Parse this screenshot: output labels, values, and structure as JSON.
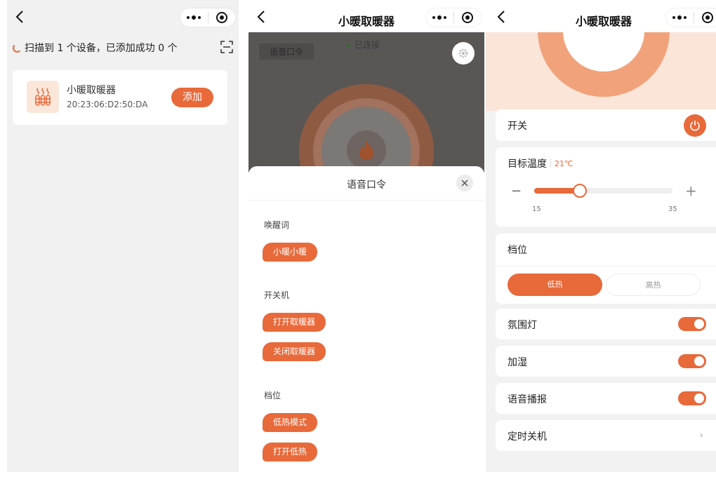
{
  "panel1": {
    "scan_status": "扫描到 1 个设备，已添加成功 0 个",
    "device": {
      "name": "小暖取暖器",
      "mac": "20:23:06:D2:50:DA",
      "add_label": "添加"
    }
  },
  "panel2": {
    "title": "小暖取暖器",
    "background": {
      "chip_label": "语音口令",
      "status": "已连接"
    },
    "sheet": {
      "title": "语音口令",
      "groups": [
        {
          "label": "唤醒词",
          "commands": [
            "小暖小暖"
          ]
        },
        {
          "label": "开关机",
          "commands": [
            "打开取暖器",
            "关闭取暖器"
          ]
        },
        {
          "label": "档位",
          "commands": [
            "低热模式",
            "打开低热"
          ]
        }
      ]
    }
  },
  "panel3": {
    "title": "小暖取暖器",
    "power": {
      "label": "开关",
      "on": true
    },
    "temperature": {
      "label": "目标温度",
      "value_text": "21℃",
      "value": 21,
      "min": 15,
      "max": 35,
      "min_label": "15",
      "max_label": "35",
      "minus": "−",
      "plus": "+"
    },
    "gear": {
      "label": "档位",
      "options": [
        "低热",
        "高热"
      ],
      "selected": "低热"
    },
    "toggles": [
      {
        "label": "氛围灯",
        "on": true
      },
      {
        "label": "加湿",
        "on": true
      },
      {
        "label": "语音播报",
        "on": true
      }
    ],
    "timer": {
      "label": "定时关机",
      "chevron": "›"
    }
  },
  "colors": {
    "accent": "#e8693a",
    "accent_light": "#fbe6da",
    "page_bg": "#f2f2f2"
  }
}
